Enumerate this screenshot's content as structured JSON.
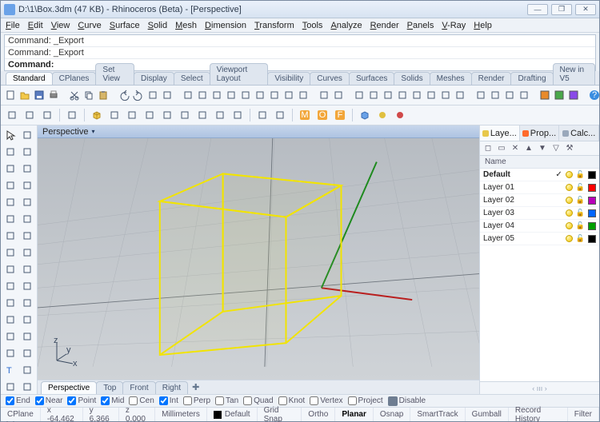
{
  "title": "D:\\1\\Box.3dm (47 KB) - Rhinoceros (Beta) - [Perspective]",
  "menu": [
    "File",
    "Edit",
    "View",
    "Curve",
    "Surface",
    "Solid",
    "Mesh",
    "Dimension",
    "Transform",
    "Tools",
    "Analyze",
    "Render",
    "Panels",
    "V-Ray",
    "Help"
  ],
  "command_history": [
    "Command: _Export",
    "Command: _Export"
  ],
  "command_prompt": "Command:",
  "tool_tabs": [
    "Standard",
    "CPlanes",
    "Set View",
    "Display",
    "Select",
    "Viewport Layout",
    "Visibility",
    "Curves",
    "Surfaces",
    "Solids",
    "Meshes",
    "Render",
    "Drafting",
    "New in V5"
  ],
  "active_tool_tab": 0,
  "viewport_label": "Perspective",
  "vp_tabs": [
    "Perspective",
    "Top",
    "Front",
    "Right"
  ],
  "active_vp_tab": 0,
  "panel_tabs": [
    {
      "label": "Laye...",
      "color": "#e8c84a"
    },
    {
      "label": "Prop...",
      "color": "#ff6a2b"
    },
    {
      "label": "Calc...",
      "color": "#9aa8bb"
    }
  ],
  "active_panel_tab": 0,
  "layer_header": "Name",
  "layers": [
    {
      "name": "Default",
      "bold": true,
      "check": true,
      "color": "#000000"
    },
    {
      "name": "Layer 01",
      "bold": false,
      "check": false,
      "color": "#ff0000"
    },
    {
      "name": "Layer 02",
      "bold": false,
      "check": false,
      "color": "#b800b8"
    },
    {
      "name": "Layer 03",
      "bold": false,
      "check": false,
      "color": "#0066ff"
    },
    {
      "name": "Layer 04",
      "bold": false,
      "check": false,
      "color": "#00a000"
    },
    {
      "name": "Layer 05",
      "bold": false,
      "check": false,
      "color": "#000000"
    }
  ],
  "osnaps": [
    {
      "label": "End",
      "on": true
    },
    {
      "label": "Near",
      "on": true
    },
    {
      "label": "Point",
      "on": true
    },
    {
      "label": "Mid",
      "on": true
    },
    {
      "label": "Cen",
      "on": false
    },
    {
      "label": "Int",
      "on": true
    },
    {
      "label": "Perp",
      "on": false
    },
    {
      "label": "Tan",
      "on": false
    },
    {
      "label": "Quad",
      "on": false
    },
    {
      "label": "Knot",
      "on": false
    },
    {
      "label": "Vertex",
      "on": false
    },
    {
      "label": "Project",
      "on": false
    }
  ],
  "osnap_disable": "Disable",
  "status": {
    "cplane": "CPlane",
    "x": "x -64.462",
    "y": "y 6.366",
    "z": "z 0.000",
    "units": "Millimeters",
    "layer": "Default",
    "toggles": [
      "Grid Snap",
      "Ortho",
      "Planar",
      "Osnap",
      "SmartTrack",
      "Gumball",
      "Record History",
      "Filter"
    ],
    "bold_toggle": "Planar"
  },
  "win_btns": [
    "—",
    "❐",
    "✕"
  ],
  "icons_main": [
    "doc-new",
    "folder-open",
    "save",
    "print",
    "sep",
    "cut",
    "copy",
    "paste",
    "sep",
    "undo",
    "redo",
    "undo-views",
    "redo-views",
    "sep",
    "move",
    "rotate",
    "rotate3d",
    "scale",
    "orbit",
    "pan",
    "zoom",
    "zoom-ext",
    "zoom-sel",
    "sep",
    "4view",
    "single",
    "sep",
    "car",
    "shade",
    "ghost",
    "wire",
    "render",
    "render2",
    "bulb",
    "lamp",
    "sep",
    "options",
    "layers",
    "props",
    "sel-filter",
    "sep",
    "swatch-o",
    "swatch-g",
    "swatch-b",
    "sep",
    "help"
  ],
  "icons_row2": [
    "spotlight",
    "cone",
    "arrow-r",
    "sep",
    "square",
    "sep",
    "box",
    "box-wire",
    "box-open",
    "sphere",
    "cyl",
    "poly",
    "teapot",
    "human",
    "chain",
    "sep",
    "cogs",
    "gear",
    "sep",
    "m-orange",
    "o-orange",
    "f-orange",
    "sep",
    "cube-blue",
    "gear-y",
    "star-r"
  ],
  "icons_left": [
    "cursor",
    "lasso",
    "polyline",
    "circle",
    "circle3",
    "arc",
    "arc2",
    "rect",
    "poly5",
    "ellipse",
    "curve-pts",
    "spline",
    "curve-tan",
    "curve-net",
    "box-s",
    "sphere-s",
    "cone-s",
    "ellipsoid",
    "extrude",
    "extrude2",
    "revolve",
    "boolean",
    "fillet",
    "chamfer",
    "sweep",
    "loft",
    "arrow-b",
    "blend",
    "text-T",
    "dim",
    "dim2",
    "trim",
    "split",
    "explode",
    "join"
  ]
}
